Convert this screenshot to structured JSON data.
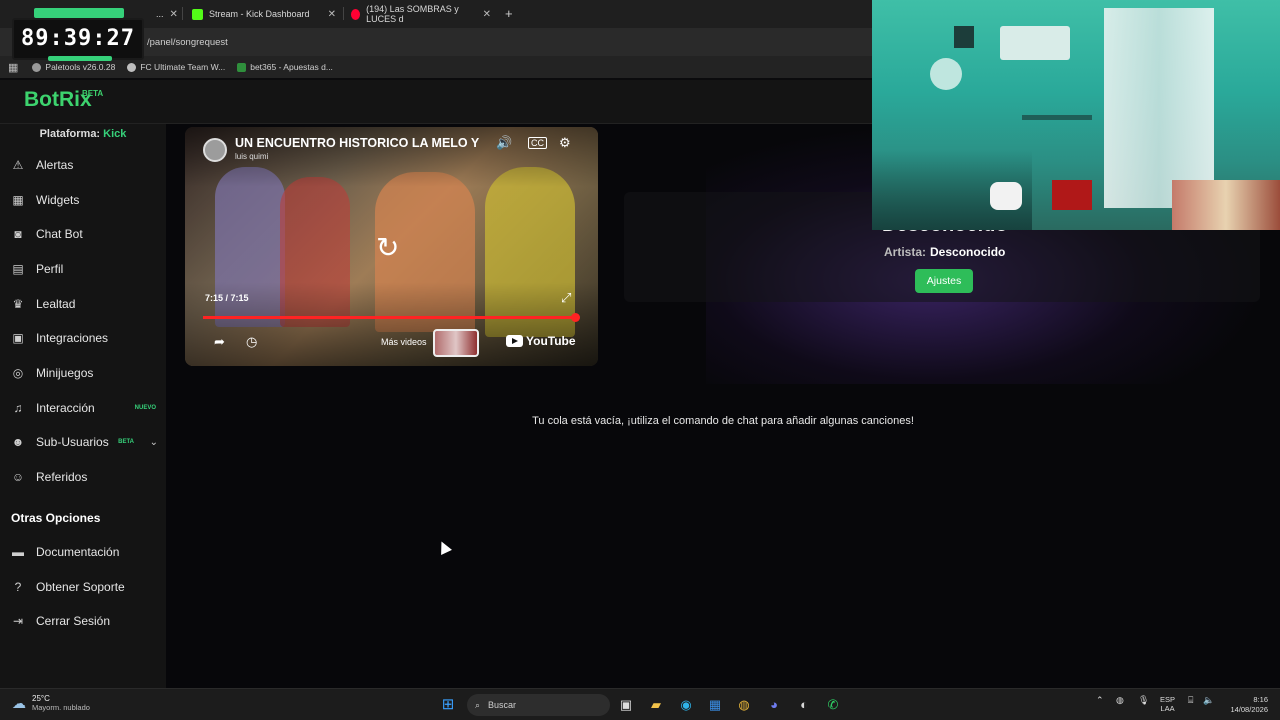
{
  "browser": {
    "tabs": [
      {
        "label": "...",
        "icon": "kick-icon",
        "color": "#53fc18"
      },
      {
        "label": "Stream - Kick Dashboard",
        "icon": "kick-icon",
        "color": "#53fc18"
      },
      {
        "label": "(194) Las SOMBRAS y LUCES d",
        "icon": "youtube-icon",
        "color": "#ff0033"
      }
    ],
    "url": "/panel/songrequest",
    "bookmarks": [
      "Paletools v26.0.28",
      "FC Ultimate Team W...",
      "bet365 - Apuestas d..."
    ]
  },
  "timer": {
    "value": "89:39:27"
  },
  "app": {
    "logo": "BotRix",
    "logo_badge": "BETA",
    "platform_label": "Plataforma:",
    "platform_value": "Kick"
  },
  "sidebar": {
    "items": [
      {
        "label": "Alertas",
        "icon": "warning-icon"
      },
      {
        "label": "Widgets",
        "icon": "grid-icon"
      },
      {
        "label": "Chat Bot",
        "icon": "robot-icon"
      },
      {
        "label": "Perfil",
        "icon": "id-card-icon"
      },
      {
        "label": "Lealtad",
        "icon": "trophy-icon"
      },
      {
        "label": "Integraciones",
        "icon": "puzzle-icon"
      },
      {
        "label": "Minijuegos",
        "icon": "gamepad-icon"
      },
      {
        "label": "Interacción",
        "icon": "music-icon",
        "badge": "NUEVO"
      },
      {
        "label": "Sub-Usuarios",
        "icon": "users-icon",
        "badge": "BETA"
      },
      {
        "label": "Referidos",
        "icon": "referral-icon"
      }
    ],
    "other_title": "Otras Opciones",
    "other_items": [
      {
        "label": "Documentación",
        "icon": "document-icon"
      },
      {
        "label": "Obtener Soporte",
        "icon": "help-icon"
      },
      {
        "label": "Cerrar Sesión",
        "icon": "logout-icon"
      }
    ]
  },
  "video": {
    "title": "UN ENCUENTRO HISTORICO LA MELO Y",
    "channel": "luis quimi",
    "time": "7:15 / 7:15",
    "more_label": "Más videos",
    "brand": "YouTube",
    "progress": 1.0
  },
  "now_playing": {
    "title": "Desconocido",
    "artist_label": "Artista:",
    "artist_value": "Desconocido",
    "settings_button": "Ajustes"
  },
  "queue": {
    "empty_message": "Tu cola está vacía, ¡utiliza el comando de chat para añadir algunas canciones!"
  },
  "taskbar": {
    "temperature": "25°C",
    "weather_desc": "Mayorm. nublado",
    "search_placeholder": "Buscar",
    "lang_1": "ESP",
    "lang_2": "LAA",
    "time": "8:16",
    "date": "14/08/2026"
  },
  "colors": {
    "accent": "#36d17a",
    "button": "#2ebd59",
    "progress": "#ff2323"
  }
}
